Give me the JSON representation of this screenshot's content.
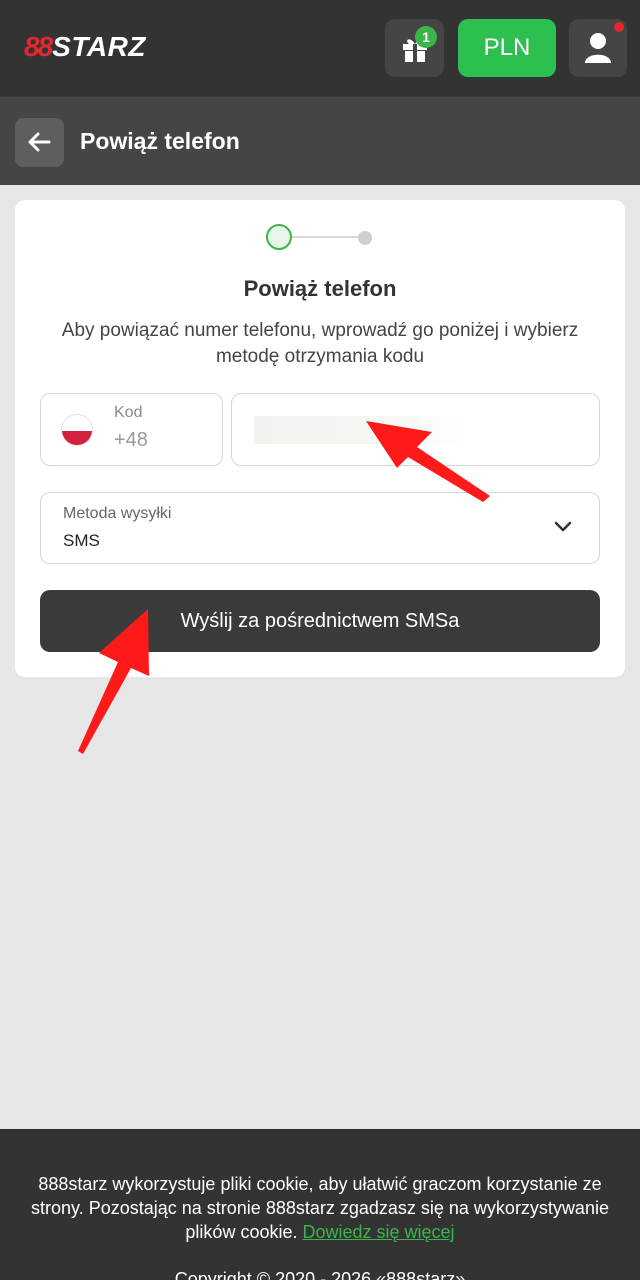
{
  "header": {
    "logo_mark": "88",
    "logo_text": "STARZ",
    "gift_badge": "1",
    "currency": "PLN"
  },
  "subheader": {
    "title": "Powiąż telefon"
  },
  "form": {
    "title": "Powiąż telefon",
    "description": "Aby powiązać numer telefonu, wprowadź go poniżej i wybierz metodę otrzymania kodu",
    "code_label": "Kod",
    "code_value": "+48",
    "phone_value": "",
    "method_label": "Metoda wysyłki",
    "method_value": "SMS",
    "submit_label": "Wyślij za pośrednictwem SMSa"
  },
  "footer": {
    "cookie_text": "888starz wykorzystuje pliki cookie, aby ułatwić graczom korzystanie ze strony. Pozostając na stronie 888starz zgadzasz się na wykorzystywanie plików cookie.",
    "cookie_link": "Dowiedz się więcej",
    "copyright": "Copyright © 2020 - 2026 «888starz»"
  },
  "colors": {
    "brand_red": "#e4262f",
    "accent_green": "#2dbf4f",
    "header_bg": "#333333",
    "annotation_arrow": "#ff1a1a"
  },
  "icons": [
    "logo",
    "gift-icon",
    "user-icon",
    "back-arrow-icon",
    "poland-flag-icon",
    "chevron-down-icon"
  ]
}
